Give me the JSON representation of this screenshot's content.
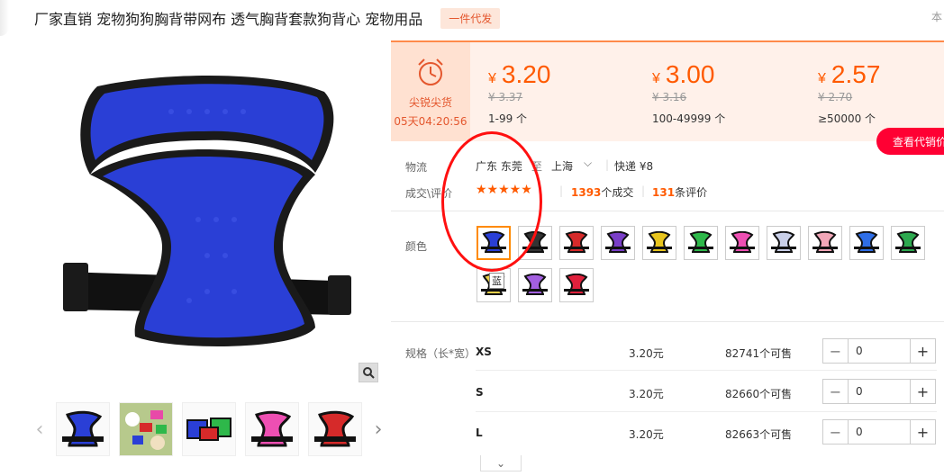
{
  "header": {
    "title": "厂家直销 宠物狗狗胸背带网布 透气胸背套款狗背心 宠物用品",
    "badge": "一件代发",
    "corner_text": "本"
  },
  "flash_sale": {
    "label": "尖锐尖货",
    "countdown": "05天04:20:56"
  },
  "price_tiers": [
    {
      "currency": "¥",
      "price": "3.20",
      "original": "¥ 3.37",
      "qty": "1-99 个"
    },
    {
      "currency": "¥",
      "price": "3.00",
      "original": "¥ 3.16",
      "qty": "100-49999 个"
    },
    {
      "currency": "¥",
      "price": "2.57",
      "original": "¥ 2.70",
      "qty": "≥50000 个"
    }
  ],
  "view_button": "查看代销价",
  "logistics": {
    "label": "物流",
    "from": "广东 东莞",
    "to_word": "至",
    "to": "上海",
    "shipping": "快递 ¥8"
  },
  "sales": {
    "label": "成交\\评价",
    "deals_count": "1393",
    "deals_suffix": "个成交",
    "reviews_count": "131",
    "reviews_suffix": "条评价",
    "rating_stars": 5
  },
  "color": {
    "label": "颜色",
    "tooltip": "蓝",
    "swatches": [
      "#2a3fd6",
      "#333333",
      "#d62a2a",
      "#7a3fc8",
      "#e8c51e",
      "#2eb84a",
      "#ee4fb3",
      "#c9cfe8",
      "#f2a7b8",
      "#2f6ee6",
      "#2da94f",
      "#e8d04a",
      "#a35fe0",
      "#e0203c"
    ],
    "selected_index": 0
  },
  "specs": {
    "label": "规格（长*宽）",
    "rows": [
      {
        "name": "XS",
        "price": "3.20元",
        "stock": "82741个可售",
        "qty": "0"
      },
      {
        "name": "S",
        "price": "3.20元",
        "stock": "82660个可售",
        "qty": "0"
      },
      {
        "name": "L",
        "price": "3.20元",
        "stock": "82663个可售",
        "qty": "0"
      }
    ]
  },
  "thumbnails": [
    "blue-harness",
    "dogs-photo",
    "multi-harness",
    "pink-harness",
    "red-harness"
  ],
  "colors": {
    "accent": "#ff5a00",
    "panel_bg": "#fff1ea",
    "red_button": "#ff0033"
  }
}
